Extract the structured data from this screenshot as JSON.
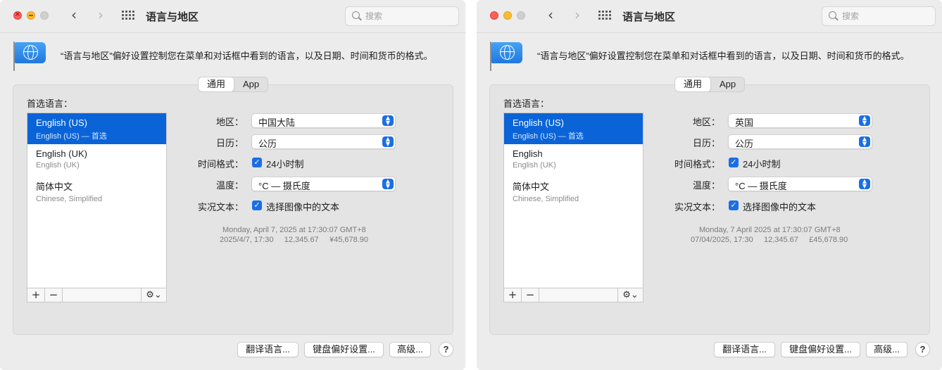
{
  "windows": [
    {
      "title": "语言与地区",
      "search_placeholder": "搜索",
      "description": "“语言与地区”偏好设置控制您在菜单和对话框中看到的语言，以及日期、时间和货币的格式。",
      "tabs": [
        "通用",
        "App"
      ],
      "preferred_languages_label": "首选语言：",
      "languages": [
        {
          "name": "English (US)",
          "sub": "English (US) — 首选",
          "selected": true
        },
        {
          "name": "English (UK)",
          "sub": "English (UK)",
          "selected": false
        },
        {
          "name": "简体中文",
          "sub": "Chinese, Simplified",
          "selected": false
        }
      ],
      "list_toolbar": {
        "add": "+",
        "remove": "−",
        "gear": "⚙︎⌄"
      },
      "region_label": "地区：",
      "region_value": "中国大陆",
      "calendar_label": "日历：",
      "calendar_value": "公历",
      "time_format_label": "时间格式：",
      "time_format_value": "24小时制",
      "time_format_checked": true,
      "temperature_label": "温度：",
      "temperature_value": "°C — 摄氏度",
      "live_text_label": "实况文本：",
      "live_text_value": "选择图像中的文本",
      "live_text_checked": true,
      "sample_line1": "Monday, April 7, 2025 at 17:30:07 GMT+8",
      "sample_line2": "2025/4/7, 17:30     12,345.67     ¥45,678.90",
      "buttons": {
        "translation": "翻译语言...",
        "keyboard": "键盘偏好设置...",
        "advanced": "高级...",
        "help": "?"
      }
    },
    {
      "title": "语言与地区",
      "search_placeholder": "搜索",
      "description": "“语言与地区”偏好设置控制您在菜单和对话框中看到的语言，以及日期、时间和货币的格式。",
      "tabs": [
        "通用",
        "App"
      ],
      "preferred_languages_label": "首选语言：",
      "languages": [
        {
          "name": "English (US)",
          "sub": "English (US) — 首选",
          "selected": true
        },
        {
          "name": "English",
          "sub": "English (UK)",
          "selected": false
        },
        {
          "name": "简体中文",
          "sub": "Chinese, Simplified",
          "selected": false
        }
      ],
      "list_toolbar": {
        "add": "+",
        "remove": "−",
        "gear": "⚙︎⌄"
      },
      "region_label": "地区：",
      "region_value": "英国",
      "calendar_label": "日历：",
      "calendar_value": "公历",
      "time_format_label": "时间格式：",
      "time_format_value": "24小时制",
      "time_format_checked": true,
      "temperature_label": "温度：",
      "temperature_value": "°C — 摄氏度",
      "live_text_label": "实况文本：",
      "live_text_value": "选择图像中的文本",
      "live_text_checked": true,
      "sample_line1": "Monday, 7 April 2025 at 17:30:07 GMT+8",
      "sample_line2": "07/04/2025, 17:30     12,345.67     £45,678.90",
      "buttons": {
        "translation": "翻译语言...",
        "keyboard": "键盘偏好设置...",
        "advanced": "高级...",
        "help": "?"
      }
    }
  ],
  "colors": {
    "accent": "#0a64d8",
    "window_bg": "#ececec",
    "panel_bg": "#e4e4e4"
  },
  "icons": {
    "flag": "globe-flag-icon",
    "search": "search-icon",
    "grid": "grid-icon",
    "back": "chevron-left-icon",
    "forward": "chevron-right-icon",
    "gear": "gear-icon"
  }
}
